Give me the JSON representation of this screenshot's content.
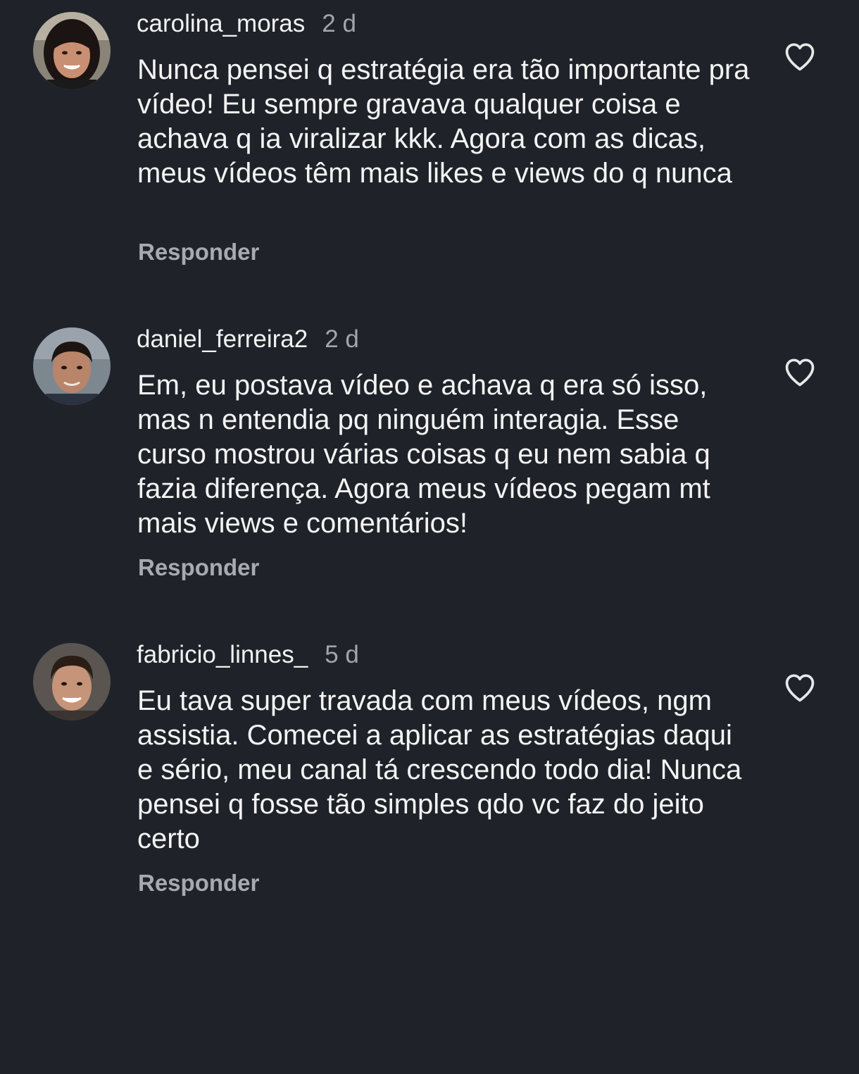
{
  "comments": [
    {
      "username": "carolina_moras",
      "time": "2 d",
      "text": "Nunca pensei q estratégia era tão importante pra vídeo! Eu sempre gravava qualquer coisa e achava q ia viralizar kkk. Agora com as dicas, meus vídeos têm mais likes e views do q nunca",
      "reply_label": "Responder",
      "like_icon": "heart-outline-icon"
    },
    {
      "username": "daniel_ferreira2",
      "time": "2 d",
      "text": "Em, eu postava vídeo e achava q era só isso, mas n entendia pq ninguém interagia. Esse curso mostrou várias coisas q eu nem sabia q fazia diferença. Agora meus vídeos pegam mt mais views e comentários!",
      "reply_label": "Responder",
      "like_icon": "heart-outline-icon"
    },
    {
      "username": "fabricio_linnes_",
      "time": "5 d",
      "text": "Eu tava super travada com meus vídeos, ngm assistia. Comecei a aplicar as estratégias daqui e sério, meu canal tá crescendo todo dia! Nunca pensei q fosse tão simples qdo vc faz do jeito certo",
      "reply_label": "Responder",
      "like_icon": "heart-outline-icon"
    }
  ],
  "colors": {
    "background": "#1f2329",
    "text": "#f4f4f4",
    "secondary_text": "#a2a6ab"
  }
}
